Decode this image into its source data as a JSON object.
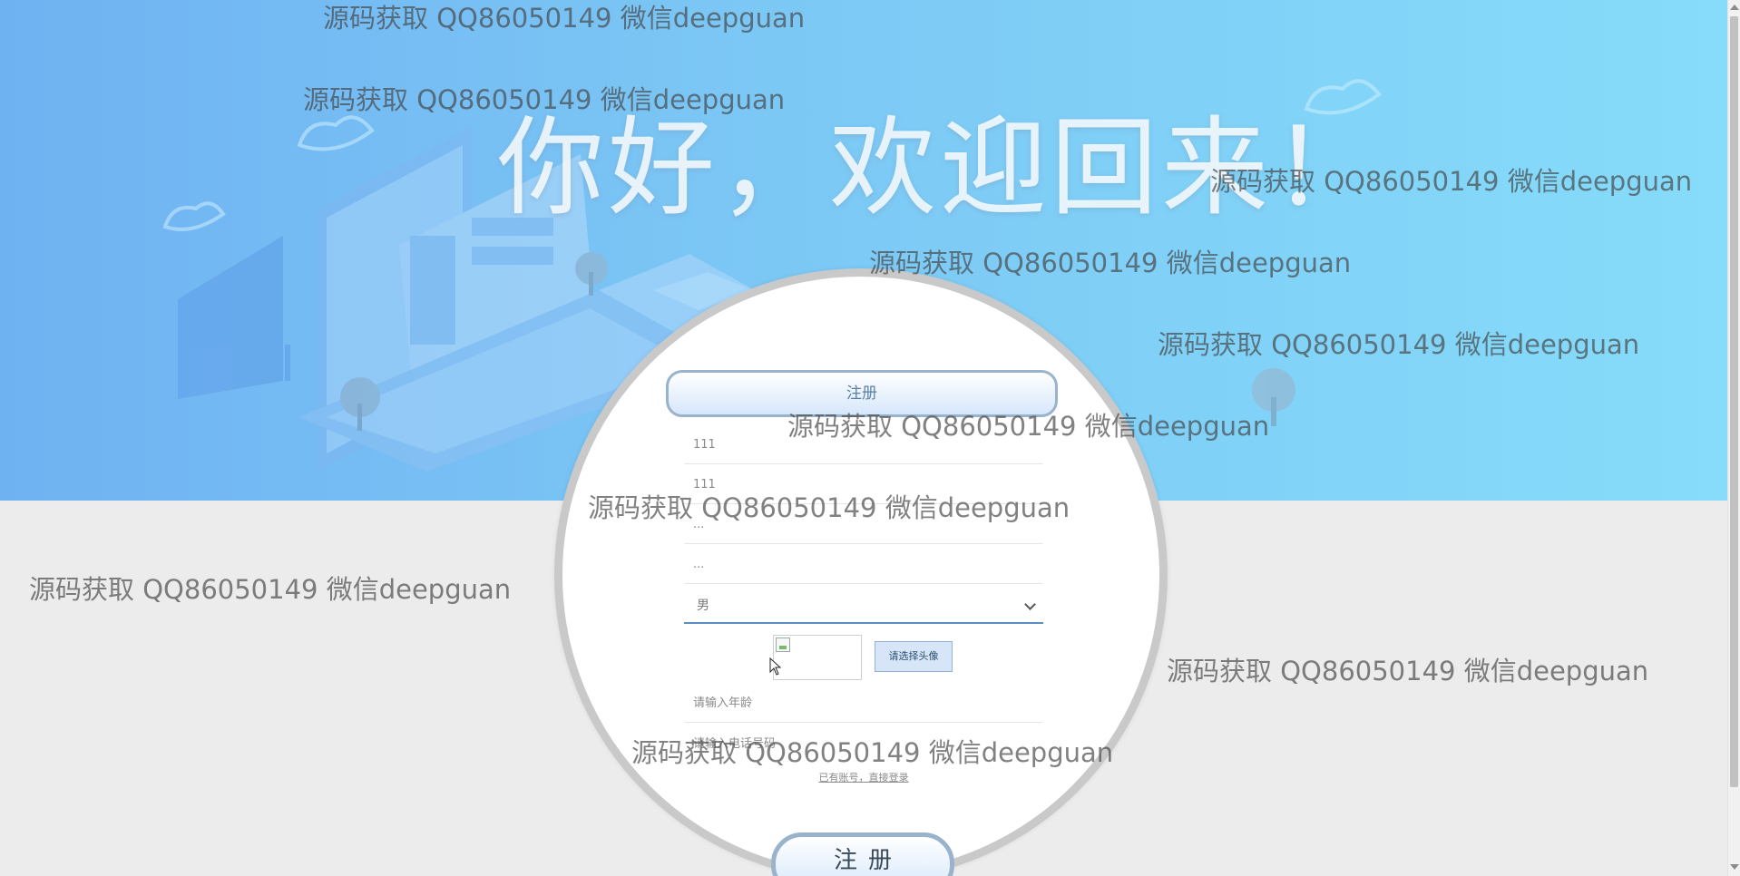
{
  "hero": {
    "title": "你好，欢迎回来！"
  },
  "form": {
    "tab_label": "注册",
    "fields": [
      {
        "value": "111"
      },
      {
        "value": "111"
      },
      {
        "value": "..."
      },
      {
        "value": "..."
      }
    ],
    "gender_select": {
      "selected": "男"
    },
    "avatar": {
      "choose_label": "请选择头像"
    },
    "age_placeholder": "请输入年龄",
    "phone_placeholder": "请输入电话号码",
    "login_link": "已有账号，直接登录",
    "submit_label": "注册"
  },
  "watermark_text": "源码获取 QQ86050149 微信deepguan",
  "colors": {
    "banner_start": "#6fb2f2",
    "banner_end": "#86dcfa",
    "accent": "#5a8ec6",
    "background": "#ececec"
  }
}
